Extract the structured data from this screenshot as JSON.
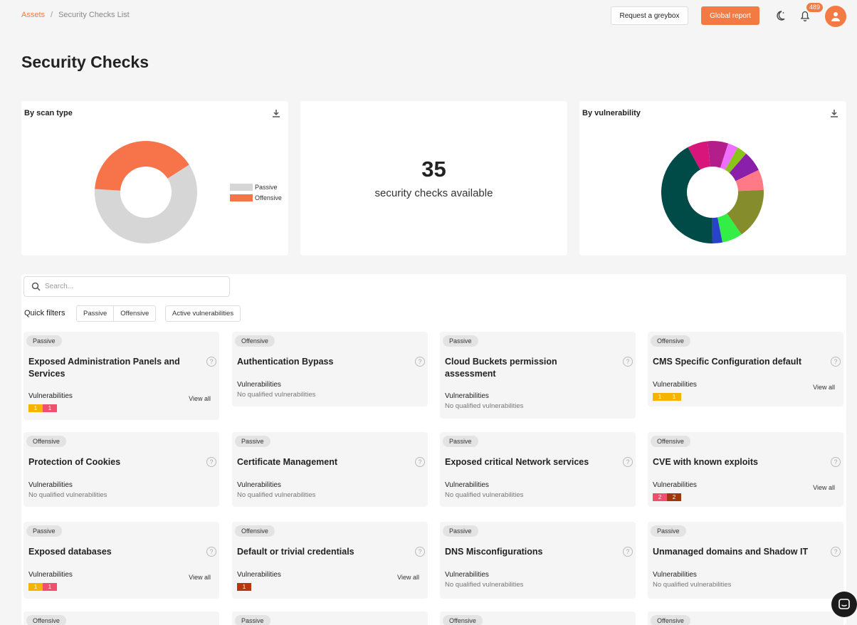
{
  "breadcrumb": {
    "root": "Assets",
    "sep": "/",
    "current": "Security Checks List"
  },
  "header": {
    "request_label": "Request a greybox",
    "report_label": "Global report",
    "notif_count": "489",
    "moon_icon": "moon-icon",
    "bell_icon": "bell-icon",
    "avatar_icon": "user-icon"
  },
  "page": {
    "title": "Security Checks"
  },
  "scan_panel": {
    "title": "By scan type",
    "legend": [
      "Passive",
      "Offensive"
    ]
  },
  "count_panel": {
    "number": "35",
    "text": "security checks available"
  },
  "vuln_panel": {
    "title": "By vulnerability"
  },
  "chart_data": [
    {
      "type": "pie",
      "title": "By scan type",
      "categories": [
        "Passive",
        "Offensive"
      ],
      "values": [
        21,
        14
      ],
      "colors": [
        "#d6d6d6",
        "#f7744b"
      ],
      "legend": "right"
    },
    {
      "type": "pie",
      "title": "By vulnerability",
      "categories": [],
      "values": [
        2,
        1,
        1,
        2,
        2,
        5,
        2,
        1,
        13,
        2
      ],
      "colors": [
        "#b31e8a",
        "#ee6fff",
        "#8ac41a",
        "#8a1faa",
        "#ff7a86",
        "#858c2c",
        "#33ee44",
        "#2842c8",
        "#004a47",
        "#d8157a"
      ],
      "legend": "none"
    }
  ],
  "search": {
    "placeholder": "Search..."
  },
  "filters": {
    "label": "Quick filters",
    "passive": "Passive",
    "offensive": "Offensive",
    "active": "Active vulnerabilities"
  },
  "vuln_label": "Vulnerabilities",
  "noq_label": "No qualified vulnerabilities",
  "view_all": "View all",
  "cards": [
    {
      "tag": "Passive",
      "title": "Exposed Administration Panels and Services"
    },
    {
      "tag": "Offensive",
      "title": "Authentication Bypass"
    },
    {
      "tag": "Passive",
      "title": "Cloud Buckets permission assessment"
    },
    {
      "tag": "Offensive",
      "title": "CMS Specific Configuration default"
    },
    {
      "tag": "Offensive",
      "title": "Protection of Cookies"
    },
    {
      "tag": "Passive",
      "title": "Certificate Management"
    },
    {
      "tag": "Passive",
      "title": "Exposed critical Network services"
    },
    {
      "tag": "Offensive",
      "title": "CVE with known exploits"
    },
    {
      "tag": "Passive",
      "title": "Exposed databases"
    },
    {
      "tag": "Offensive",
      "title": "Default or trivial credentials"
    },
    {
      "tag": "Passive",
      "title": "DNS Misconfigurations"
    },
    {
      "tag": "Passive",
      "title": "Unmanaged domains and Shadow IT"
    },
    {
      "tag": "Offensive",
      "title": ""
    },
    {
      "tag": "Passive",
      "title": ""
    },
    {
      "tag": "Offensive",
      "title": ""
    },
    {
      "tag": "Offensive",
      "title": ""
    }
  ],
  "badges": {
    "c0": [
      {
        "n": "1",
        "c": "#f5b400"
      },
      {
        "n": "1",
        "c": "#f0506e"
      }
    ],
    "c3": [
      {
        "n": "1",
        "c": "#f5b400"
      },
      {
        "n": "1",
        "c": "#f5b400"
      }
    ],
    "c7": [
      {
        "n": "2",
        "c": "#f0506e"
      },
      {
        "n": "2",
        "c": "#a0360c"
      }
    ],
    "c8": [
      {
        "n": "1",
        "c": "#f5b400"
      },
      {
        "n": "1",
        "c": "#f0506e"
      }
    ],
    "c9": [
      {
        "n": "1",
        "c": "#b8360c"
      }
    ]
  }
}
